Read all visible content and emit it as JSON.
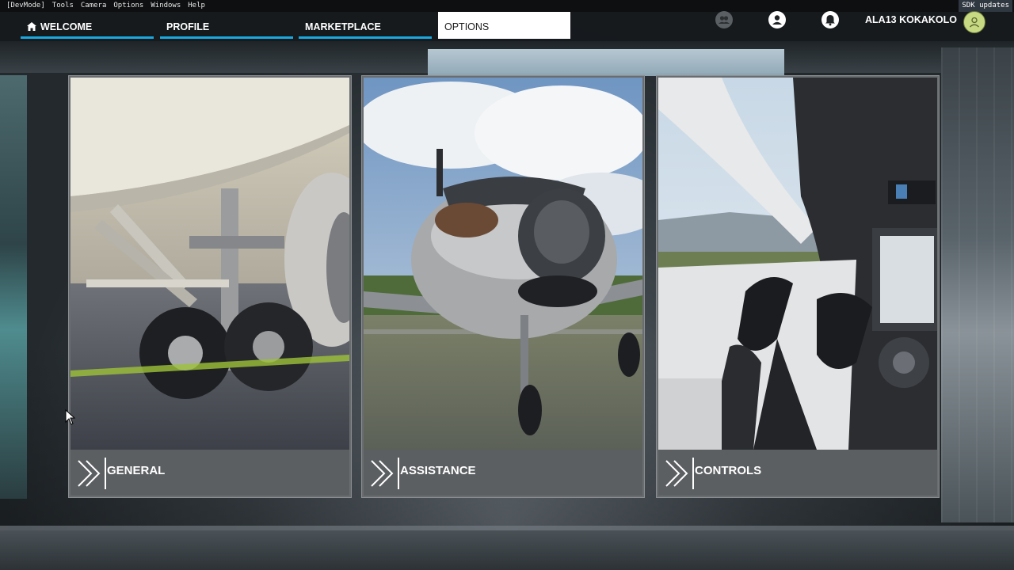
{
  "devbar": {
    "items": [
      "[DevMode]",
      "Tools",
      "Camera",
      "Options",
      "Windows",
      "Help"
    ],
    "sdk_label": "SDK updates"
  },
  "nav": {
    "tabs": [
      {
        "label": "WELCOME",
        "icon": "home-icon"
      },
      {
        "label": "PROFILE"
      },
      {
        "label": "MARKETPLACE"
      },
      {
        "label": "OPTIONS",
        "active": true
      }
    ],
    "accent_color": "#19a8e0"
  },
  "header": {
    "username": "ALA13 KOKAKOLO",
    "icons": [
      "friends-icon",
      "profile-icon",
      "notifications-icon",
      "avatar"
    ]
  },
  "cards": [
    {
      "label": "GENERAL",
      "image": "airliner-landing-gear"
    },
    {
      "label": "ASSISTANCE",
      "image": "propeller-aircraft-front"
    },
    {
      "label": "CONTROLS",
      "image": "cockpit-yoke"
    }
  ]
}
